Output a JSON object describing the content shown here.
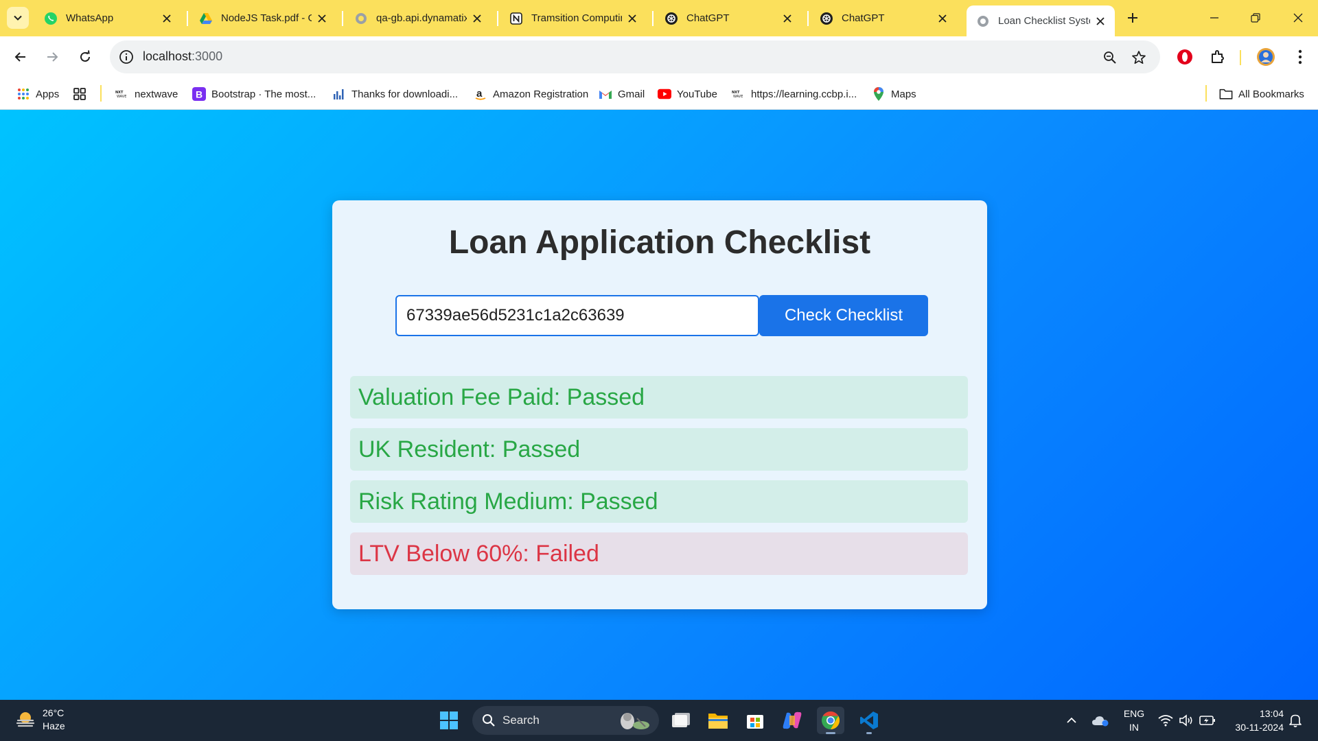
{
  "browser": {
    "tabs": [
      {
        "title": "WhatsApp",
        "icon": "whatsapp-icon"
      },
      {
        "title": "NodeJS Task.pdf - Google Drive",
        "icon": "google-drive-icon"
      },
      {
        "title": "qa-gb.api.dynamatix.com",
        "icon": "globe-icon"
      },
      {
        "title": "Tramsition Computing",
        "icon": "notion-icon"
      },
      {
        "title": "ChatGPT",
        "icon": "chatgpt-icon"
      },
      {
        "title": "ChatGPT",
        "icon": "chatgpt-icon"
      },
      {
        "title": "Loan Checklist System",
        "icon": "globe-icon",
        "active": true
      }
    ],
    "address": {
      "host": "localhost",
      "port": ":3000"
    },
    "bookmarks": [
      {
        "label": "Apps",
        "icon": "apps-grid-icon"
      },
      {
        "label": "",
        "icon": "tab-groups-icon"
      },
      {
        "label": "nextwave",
        "icon": "nxtwave-icon"
      },
      {
        "label": "Bootstrap · The most...",
        "icon": "bootstrap-icon"
      },
      {
        "label": "Thanks for downloadi...",
        "icon": "bar-chart-icon"
      },
      {
        "label": "Amazon Registration",
        "icon": "amazon-icon"
      },
      {
        "label": "Gmail",
        "icon": "gmail-icon"
      },
      {
        "label": "YouTube",
        "icon": "youtube-icon"
      },
      {
        "label": "https://learning.ccbp.i...",
        "icon": "nxtwave-icon"
      },
      {
        "label": "Maps",
        "icon": "maps-pin-icon"
      }
    ],
    "all_bookmarks_label": "All Bookmarks"
  },
  "page": {
    "title": "Loan Application Checklist",
    "input_value": "67339ae56d5231c1a2c63639",
    "button_label": "Check Checklist",
    "results": [
      {
        "text": "Valuation Fee Paid: Passed",
        "status": "passed"
      },
      {
        "text": "UK Resident: Passed",
        "status": "passed"
      },
      {
        "text": "Risk Rating Medium: Passed",
        "status": "passed"
      },
      {
        "text": "LTV Below 60%: Failed",
        "status": "failed"
      }
    ]
  },
  "taskbar": {
    "weather": {
      "temp": "26°C",
      "condition": "Haze"
    },
    "search_label": "Search",
    "language": {
      "line1": "ENG",
      "line2": "IN"
    },
    "clock": {
      "time": "13:04",
      "date": "30-11-2024"
    }
  },
  "colors": {
    "tab_strip": "#fbe05c",
    "page_gradient_start": "#00c3ff",
    "page_gradient_end": "#0066ff",
    "passed_text": "#28a745",
    "failed_text": "#dc3545",
    "button_blue": "#1a73e8"
  }
}
